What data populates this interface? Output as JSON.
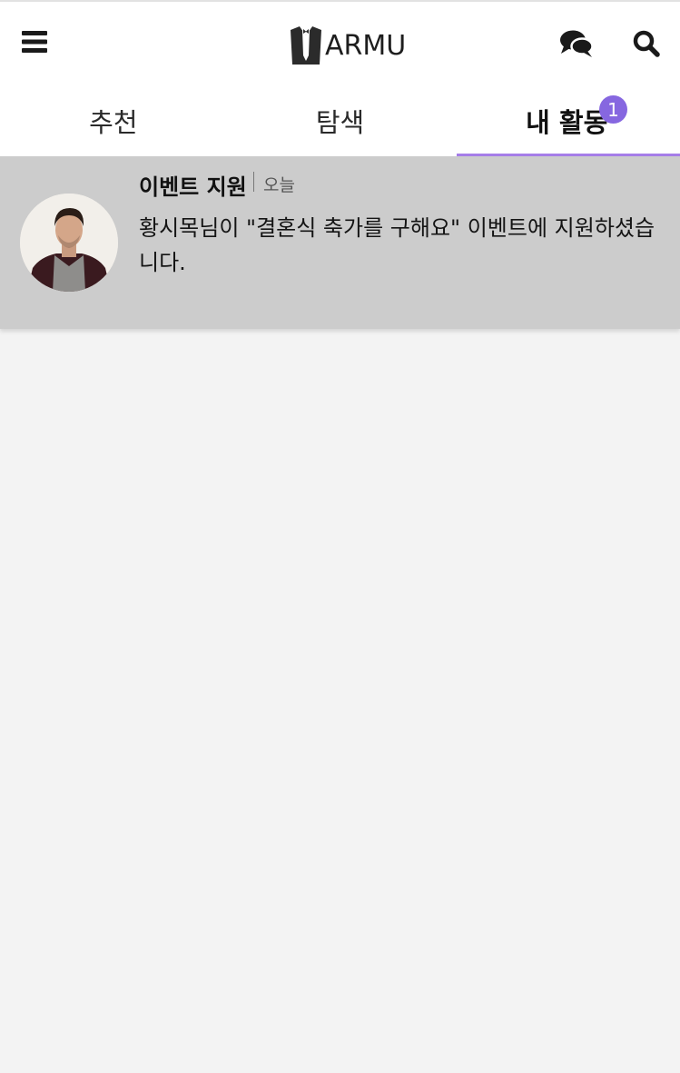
{
  "header": {
    "logo_text": "ARMU",
    "icons": {
      "menu": "menu-icon",
      "chat": "chat-bubbles-icon",
      "search": "search-icon"
    }
  },
  "tabs": [
    {
      "label": "추천",
      "active": false
    },
    {
      "label": "탐색",
      "active": false
    },
    {
      "label": "내 활동",
      "active": true,
      "badge": "1"
    }
  ],
  "notifications": [
    {
      "title": "이벤트 지원",
      "time": "오늘",
      "message": "황시목님이 \"결혼식 축가를 구해요\" 이벤트에 지원하셨습니다."
    }
  ],
  "colors": {
    "accent": "#a67ee8",
    "badge": "#8667e0",
    "notification_bg": "#cccccc",
    "page_bg": "#f3f3f3"
  }
}
